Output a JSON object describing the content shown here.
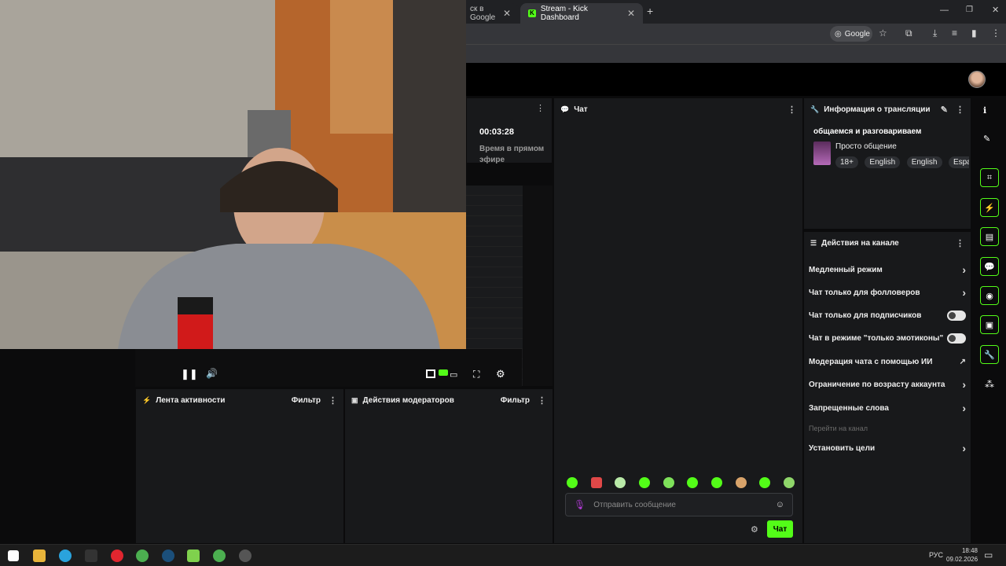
{
  "browser": {
    "tabs": [
      {
        "title": "ск в Google"
      },
      {
        "title": "Stream - Kick Dashboard"
      }
    ],
    "new_tab": "+",
    "search_engine_chip": "Google"
  },
  "stream_stats": {
    "uptime": "00:03:28",
    "uptime_label": "Время в прямом эфире"
  },
  "chat": {
    "title": "Чат",
    "placeholder": "Отправить сообщение",
    "send_label": "Чат"
  },
  "stream_info": {
    "header": "Информация о трансляции",
    "stream_title": "общаемся и разговариваем",
    "category": "Просто общение",
    "tags": [
      "18+",
      "English",
      "English",
      "Españ"
    ]
  },
  "channel_actions": {
    "header": "Действия на канале",
    "items": [
      {
        "label": "Медленный режим"
      },
      {
        "label": "Чат только для фолловеров"
      },
      {
        "label": "Чат только для подписчиков"
      },
      {
        "label": "Чат в режиме \"только эмотиконы\""
      },
      {
        "label": "Модерация чата с помощью ИИ"
      },
      {
        "label": "Ограничение по возрасту аккаунта"
      },
      {
        "label": "Запрещенные слова"
      },
      {
        "label": "Перейти на канал"
      },
      {
        "label": "Установить цели"
      }
    ]
  },
  "activity_feed": {
    "title": "Лента активности",
    "filter": "Фильтр"
  },
  "mod_actions": {
    "title": "Действия модераторов",
    "filter": "Фильтр"
  },
  "taskbar": {
    "lang": "РУС",
    "time": "18:48",
    "date": "09.02.2026"
  },
  "colors": {
    "accent": "#53fc18",
    "panel": "#18191b",
    "bg": "#0b0b0c"
  }
}
